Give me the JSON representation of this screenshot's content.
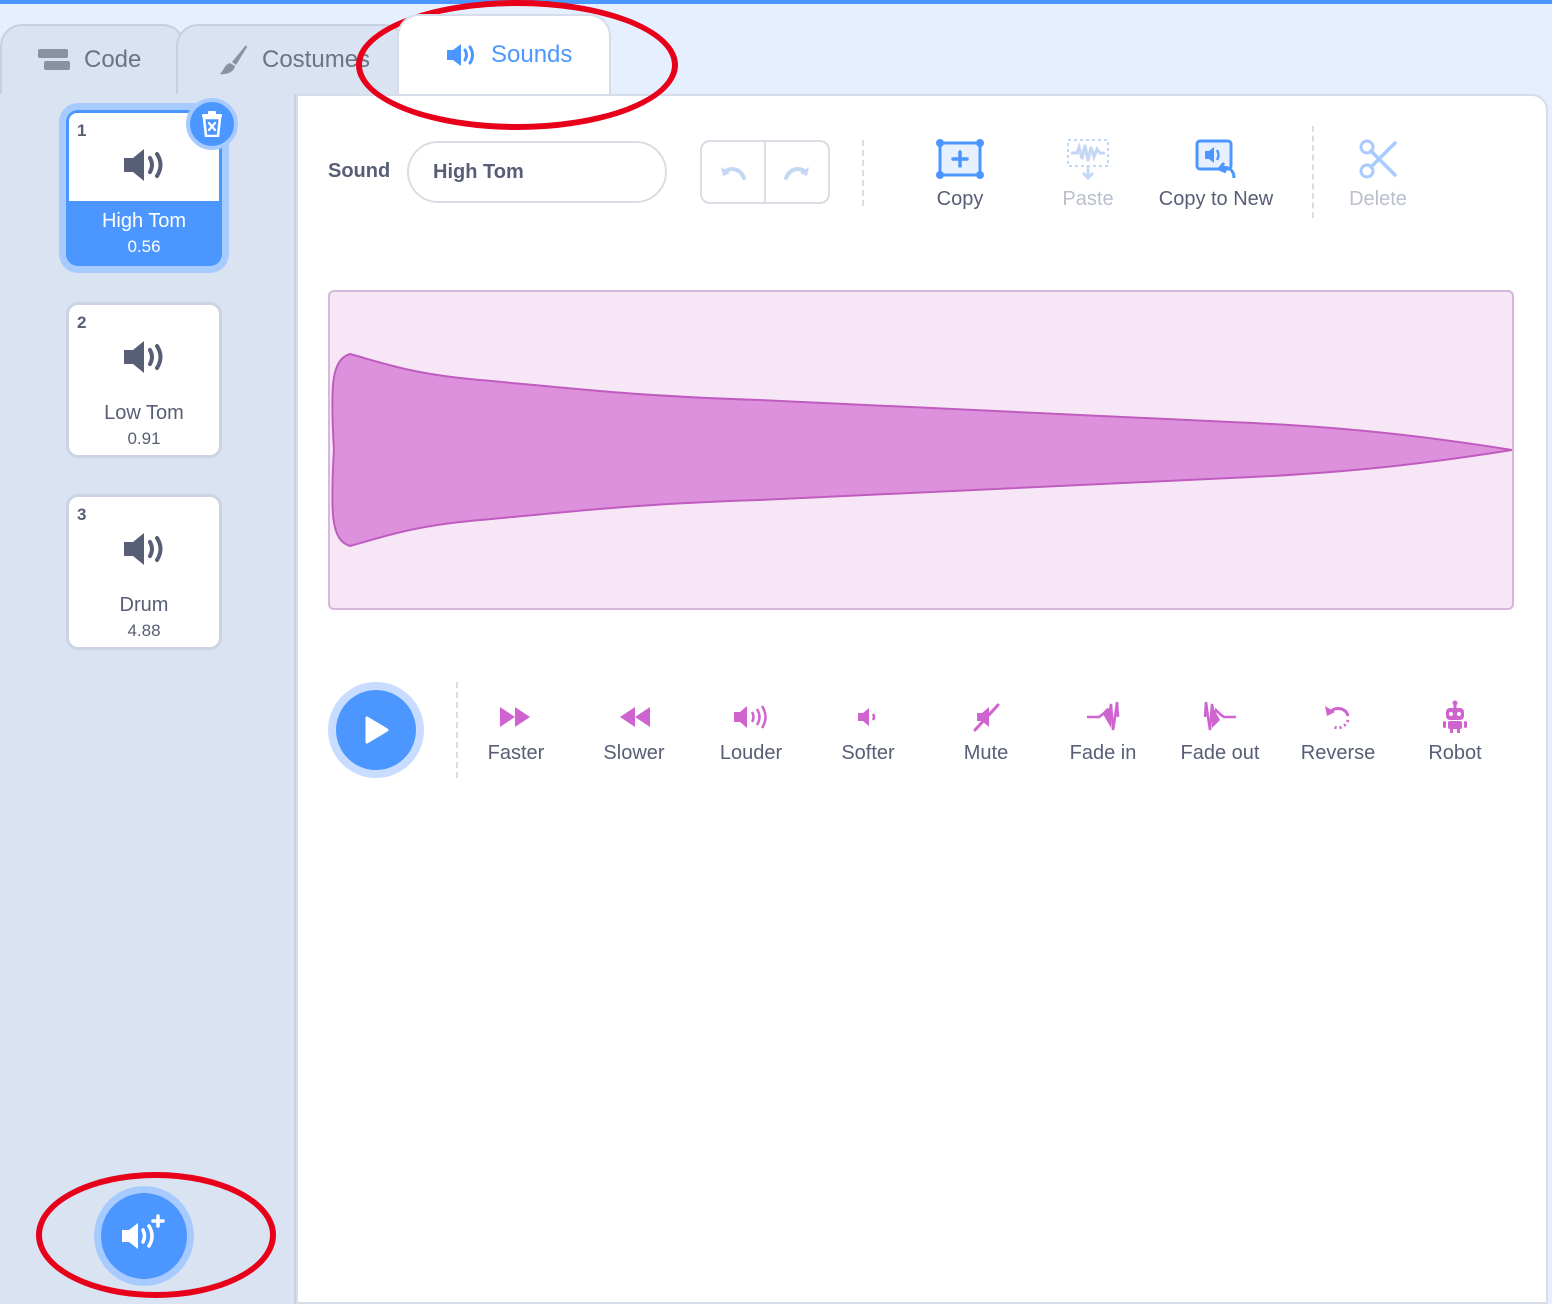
{
  "tabs": [
    {
      "label": "Code",
      "icon": "code-blocks-icon"
    },
    {
      "label": "Costumes",
      "icon": "paintbrush-icon"
    },
    {
      "label": "Sounds",
      "icon": "speaker-icon",
      "active": true
    }
  ],
  "sounds": [
    {
      "num": "1",
      "name": "High Tom",
      "duration": "0.56",
      "selected": true
    },
    {
      "num": "2",
      "name": "Low Tom",
      "duration": "0.91"
    },
    {
      "num": "3",
      "name": "Drum",
      "duration": "4.88"
    }
  ],
  "editor": {
    "sound_label": "Sound",
    "sound_name_value": "High Tom",
    "tools": {
      "copy": "Copy",
      "paste": "Paste",
      "copy_to_new": "Copy to New",
      "delete": "Delete"
    },
    "effects": [
      "Faster",
      "Slower",
      "Louder",
      "Softer",
      "Mute",
      "Fade in",
      "Fade out",
      "Reverse",
      "Robot"
    ]
  },
  "colors": {
    "accent": "#4c97ff",
    "sound_effect": "#cf63cf",
    "waveform_fill": "#dd91dd",
    "waveform_bg": "#f6e6f6",
    "annotation": "#e8001a"
  }
}
